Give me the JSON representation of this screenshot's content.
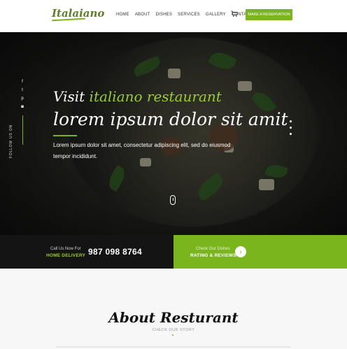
{
  "header": {
    "logo": "Italaiano",
    "nav": [
      "HOME",
      "ABOUT",
      "DISHES",
      "SERVICES",
      "GALLERY",
      "CONTACT"
    ],
    "cart_icon": "cart-icon",
    "reservation_label": "MAKE A RESERVATION"
  },
  "hero": {
    "social_icons": [
      "f",
      "t",
      "p",
      "◙"
    ],
    "follow_label": "FOLLOW US ON",
    "visit_prefix": "Visit",
    "visit_highlight": "italiano restaurant",
    "headline": "lorem ipsum dolor sit amit",
    "description": "Lorem ipsum dolor sit amet, consectetur adipiscing elit, sed do eiusmod tempor incididunt.",
    "slider_dots": 3
  },
  "bar": {
    "call_small": "Call Us Now For",
    "call_big": "HOME DELIVERY",
    "phone": "987 098 8764",
    "rate_small": "Check Our Dishes",
    "rate_big": "RATING & REVIEWS",
    "rate_arrow": "›"
  },
  "about": {
    "title": "About Resturant",
    "subtitle": "CHECK OUR STORY"
  },
  "colors": {
    "accent": "#7ab51d",
    "dark": "#141414"
  }
}
